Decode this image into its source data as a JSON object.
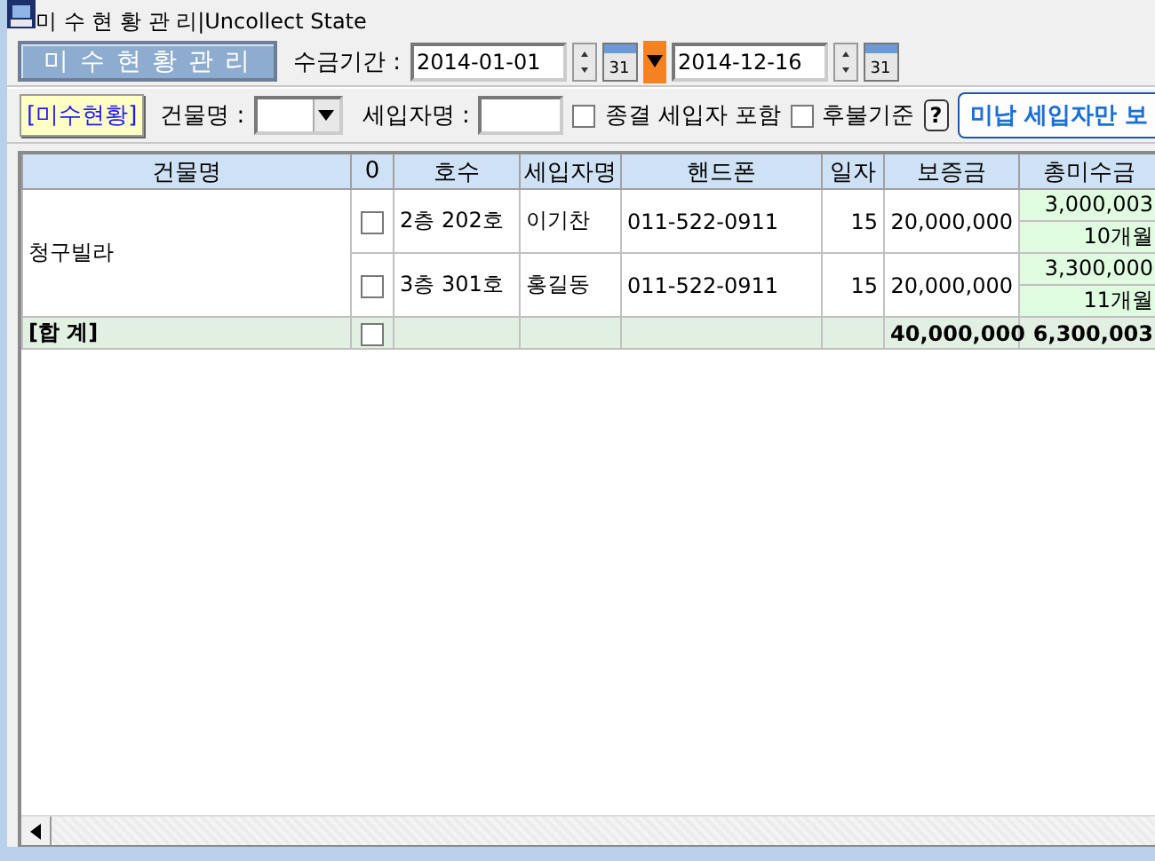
{
  "window": {
    "title": "미 수 현 황 관 리",
    "separator": "|",
    "subtitle": "Uncollect State"
  },
  "toolbar": {
    "heading": "미 수 현 황 관 리",
    "period_label": "수금기간 :",
    "start_date": "2014-01-01",
    "start_calendar": "31",
    "end_date": "2014-12-16",
    "end_calendar": "31"
  },
  "filters": {
    "status_tag": "[미수현황]",
    "building_label": "건물명 :",
    "tenant_label": "세입자명 :",
    "checkboxes": [
      {
        "label": "종결 세입자 포함",
        "checked": false
      },
      {
        "label": "후불기준",
        "checked": false
      }
    ],
    "help": "?",
    "unpaid_button": "미납 세입자만 보"
  },
  "grid": {
    "columns": [
      "건물명",
      "0",
      "호수",
      "세입자명",
      "핸드폰",
      "일자",
      "보증금",
      "총미수금"
    ],
    "groups": [
      {
        "building": "청구빌라",
        "units": [
          {
            "checked": false,
            "unit": "2층 202호",
            "tenant": "이기찬",
            "phone": "011-522-0911",
            "day": "15",
            "deposit": "20,000,000",
            "unpaid": "3,000,003",
            "months": "10개월"
          },
          {
            "checked": false,
            "unit": "3층 301호",
            "tenant": "홍길동",
            "phone": "011-522-0911",
            "day": "15",
            "deposit": "20,000,000",
            "unpaid": "3,300,000",
            "months": "11개월"
          }
        ]
      }
    ],
    "total": {
      "label": "[합 계]",
      "checked": false,
      "deposit": "40,000,000",
      "unpaid": "6,300,003"
    }
  }
}
